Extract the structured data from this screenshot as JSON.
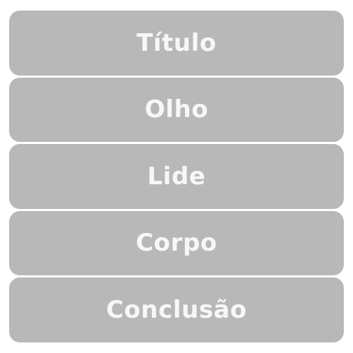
{
  "blocks": [
    {
      "label": "Título"
    },
    {
      "label": "Olho"
    },
    {
      "label": "Lide"
    },
    {
      "label": "Corpo"
    },
    {
      "label": "Conclusão"
    }
  ],
  "colors": {
    "block": "#b8b8b8",
    "text": "#f7f7f7",
    "background": "#ffffff"
  }
}
